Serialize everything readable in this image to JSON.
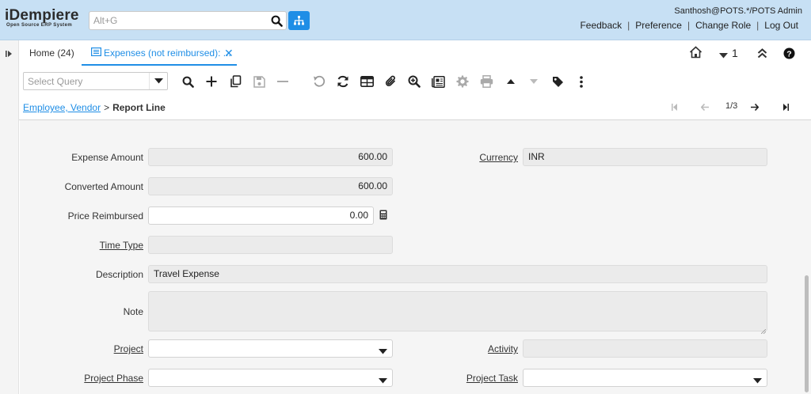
{
  "header": {
    "logo_main": "iDempiere",
    "logo_sub": "Open Source  ERP System",
    "search_placeholder": "Alt+G",
    "user": "Santhosh@POTS.*/POTS Admin",
    "links": [
      "Feedback",
      "Preference",
      "Change Role",
      "Log Out"
    ]
  },
  "tabs": {
    "home": "Home (24)",
    "active": "Expenses (not reimbursed): ...",
    "window_count": "1"
  },
  "toolbar": {
    "query_placeholder": "Select Query",
    "icons": [
      "search-icon",
      "new-icon",
      "copy-icon",
      "save-icon",
      "delete-icon",
      "undo-icon",
      "refresh-icon",
      "grid-toggle-icon",
      "attachment-icon",
      "zoom-across-icon",
      "report-icon",
      "process-icon",
      "print-icon",
      "parent-record-icon",
      "detail-record-icon",
      "tag-icon",
      "more-icon"
    ]
  },
  "breadcrumb": {
    "parent": "Employee, Vendor",
    "separator": ">",
    "current": "Report Line",
    "record": "1/3"
  },
  "form": {
    "expense_amount": {
      "label": "Expense Amount",
      "value": "600.00"
    },
    "currency": {
      "label": "Currency",
      "value": "INR"
    },
    "converted_amount": {
      "label": "Converted Amount",
      "value": "600.00"
    },
    "price_reimbursed": {
      "label": "Price Reimbursed",
      "value": "0.00"
    },
    "time_type": {
      "label": "Time Type",
      "value": ""
    },
    "description": {
      "label": "Description",
      "value": "Travel Expense"
    },
    "note": {
      "label": "Note",
      "value": ""
    },
    "project": {
      "label": "Project",
      "value": ""
    },
    "activity": {
      "label": "Activity",
      "value": ""
    },
    "project_phase": {
      "label": "Project Phase",
      "value": ""
    },
    "project_task": {
      "label": "Project Task",
      "value": ""
    }
  },
  "colors": {
    "header_bg": "#c7e0f4",
    "accent": "#1f8ee6",
    "field_readonly": "#ebebeb"
  }
}
